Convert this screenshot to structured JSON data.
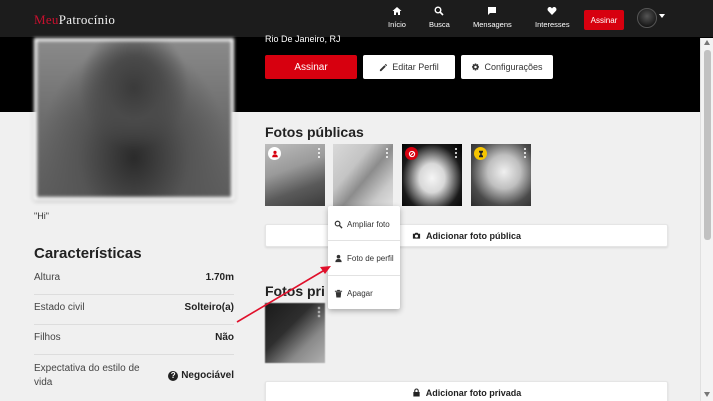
{
  "logo": {
    "part1": "Meu",
    "part2": "Patrocínio"
  },
  "nav": {
    "items": [
      {
        "label": "Início",
        "icon": "home-icon"
      },
      {
        "label": "Busca",
        "icon": "search-icon"
      },
      {
        "label": "Mensagens",
        "icon": "chat-icon"
      },
      {
        "label": "Interesses",
        "icon": "heart-icon"
      }
    ],
    "subscribe": "Assinar"
  },
  "profile": {
    "location": "Rio De Janeiro, RJ",
    "quote": "\"Hi\"",
    "actions": {
      "subscribe": "Assinar",
      "edit": "Editar Perfil",
      "settings": "Configurações"
    }
  },
  "characteristics": {
    "title": "Características",
    "rows": [
      {
        "label": "Altura",
        "value": "1.70m"
      },
      {
        "label": "Estado civil",
        "value": "Solteiro(a)"
      },
      {
        "label": "Filhos",
        "value": "Não"
      },
      {
        "label": "Expectativa do estilo de vida",
        "value": "Negociável"
      }
    ]
  },
  "public_photos": {
    "title": "Fotos públicas",
    "add_label": "Adicionar foto pública",
    "badges": [
      "profile-badge",
      "none",
      "blocked-badge",
      "pending-badge"
    ]
  },
  "private_photos": {
    "title": "Fotos privadas",
    "title_visible": "Fotos pri",
    "add_label": "Adicionar foto privada"
  },
  "menu": {
    "items": [
      {
        "label": "Ampliar foto",
        "icon": "zoom-icon"
      },
      {
        "label": "Foto de perfil",
        "icon": "person-icon"
      },
      {
        "label": "Apagar",
        "icon": "trash-icon"
      }
    ]
  },
  "colors": {
    "accent": "#d7000f",
    "navbar": "#1c1c1c",
    "badge_profile": "#d7000f",
    "badge_blocked": "#d7000f",
    "badge_pending": "#f5c400"
  }
}
